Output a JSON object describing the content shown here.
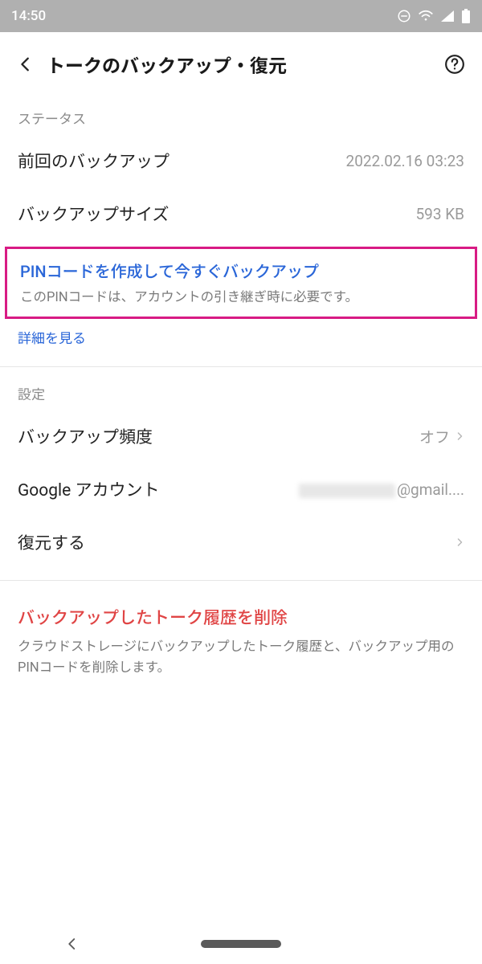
{
  "statusbar": {
    "time": "14:50"
  },
  "header": {
    "title": "トークのバックアップ・復元"
  },
  "sections": {
    "status_label": "ステータス",
    "settings_label": "設定"
  },
  "status_rows": {
    "last_backup_label": "前回のバックアップ",
    "last_backup_value": "2022.02.16 03:23",
    "backup_size_label": "バックアップサイズ",
    "backup_size_value": "593 KB"
  },
  "pin": {
    "title": "PINコードを作成して今すぐバックアップ",
    "subtitle": "このPINコードは、アカウントの引き継ぎ時に必要です。",
    "more": "詳細を見る"
  },
  "settings_rows": {
    "frequency_label": "バックアップ頻度",
    "frequency_value": "オフ",
    "google_label": "Google アカウント",
    "google_value_suffix": "@gmail....",
    "restore_label": "復元する"
  },
  "delete": {
    "title": "バックアップしたトーク履歴を削除",
    "subtitle": "クラウドストレージにバックアップしたトーク履歴と、バックアップ用のPINコードを削除します。"
  }
}
